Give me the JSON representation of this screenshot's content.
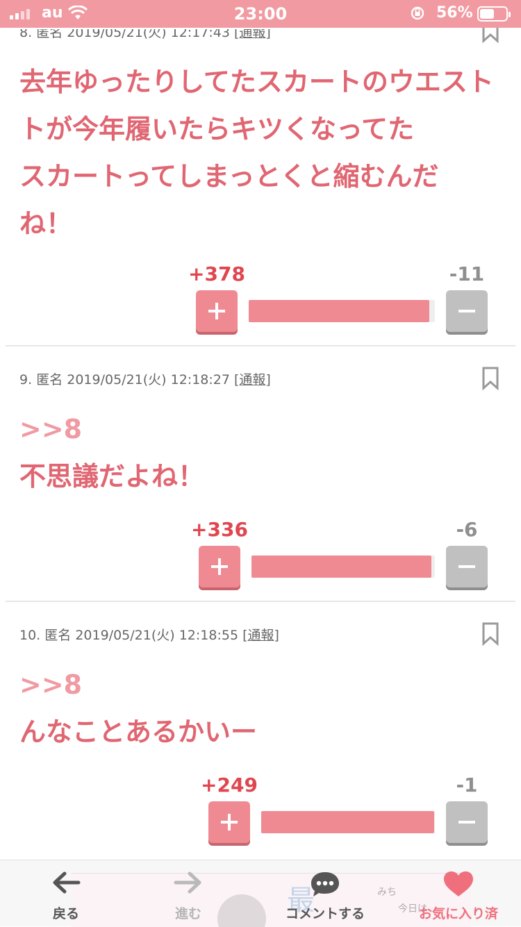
{
  "status": {
    "carrier": "au",
    "time": "23:00",
    "battery": "56%",
    "battery_level": 0.56
  },
  "comments": [
    {
      "number": "8.",
      "author": "匿名",
      "datetime": "2019/05/21(火) 12:17:43",
      "report": "[通報]",
      "lines": [
        "去年ゆったりしてたスカートのウエスト",
        "トが今年履いたらキツくなってた",
        "スカートってしまっとくと縮むんだ",
        "ね！"
      ],
      "plus": "+378",
      "minus": "-11",
      "ratio": 0.972
    },
    {
      "number": "9.",
      "author": "匿名",
      "datetime": "2019/05/21(火) 12:18:27",
      "report": "[通報]",
      "anchor": ">>8",
      "lines": [
        "不思議だよね！"
      ],
      "plus": "+336",
      "minus": "-6",
      "ratio": 0.982
    },
    {
      "number": "10.",
      "author": "匿名",
      "datetime": "2019/05/21(火) 12:18:55",
      "report": "[通報]",
      "anchor": ">>8",
      "lines": [
        "んなことあるかいー"
      ],
      "plus": "+249",
      "minus": "-1",
      "ratio": 0.996
    }
  ],
  "bottom_nav": {
    "back": "戻る",
    "forward": "進む",
    "comment": "コメントする",
    "favorite": "お気に入り済"
  },
  "ad": {
    "text1": "みち",
    "text2": "今日は",
    "kanji": "最"
  },
  "colors": {
    "accent": "#ef8a93",
    "text_pink": "#e06672",
    "plus_count": "#e0464f",
    "status_bar": "#f19aa1"
  }
}
